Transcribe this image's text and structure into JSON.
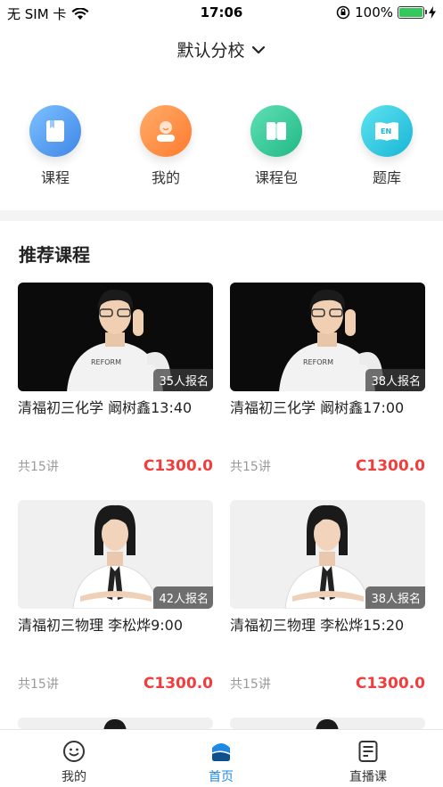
{
  "status_bar": {
    "carrier": "无 SIM 卡",
    "time": "17:06",
    "battery_percent": "100%"
  },
  "header": {
    "branch_label": "默认分校"
  },
  "quick_menu": [
    {
      "label": "课程",
      "icon": "book-icon",
      "color": "#4c9df0"
    },
    {
      "label": "我的",
      "icon": "user-icon",
      "color": "#ff8a3d"
    },
    {
      "label": "课程包",
      "icon": "package-icon",
      "color": "#2fcf9a"
    },
    {
      "label": "题库",
      "icon": "question-bank-icon",
      "color": "#2cc7e0"
    }
  ],
  "recommended": {
    "title": "推荐课程",
    "courses": [
      {
        "title": "清福初三化学 阚树鑫13:40",
        "enrolled": "35人报名",
        "lessons": "共15讲",
        "price": "C1300.0"
      },
      {
        "title": "清福初三化学 阚树鑫17:00",
        "enrolled": "38人报名",
        "lessons": "共15讲",
        "price": "C1300.0"
      },
      {
        "title": "清福初三物理 李松烨9:00",
        "enrolled": "42人报名",
        "lessons": "共15讲",
        "price": "C1300.0"
      },
      {
        "title": "清福初三物理 李松烨15:20",
        "enrolled": "38人报名",
        "lessons": "共15讲",
        "price": "C1300.0"
      }
    ]
  },
  "tabbar": {
    "tabs": [
      {
        "label": "我的",
        "icon": "smiley-icon"
      },
      {
        "label": "首页",
        "icon": "home-icon",
        "active": true
      },
      {
        "label": "直播课",
        "icon": "live-icon"
      }
    ],
    "active_color": "#1e88e5"
  }
}
